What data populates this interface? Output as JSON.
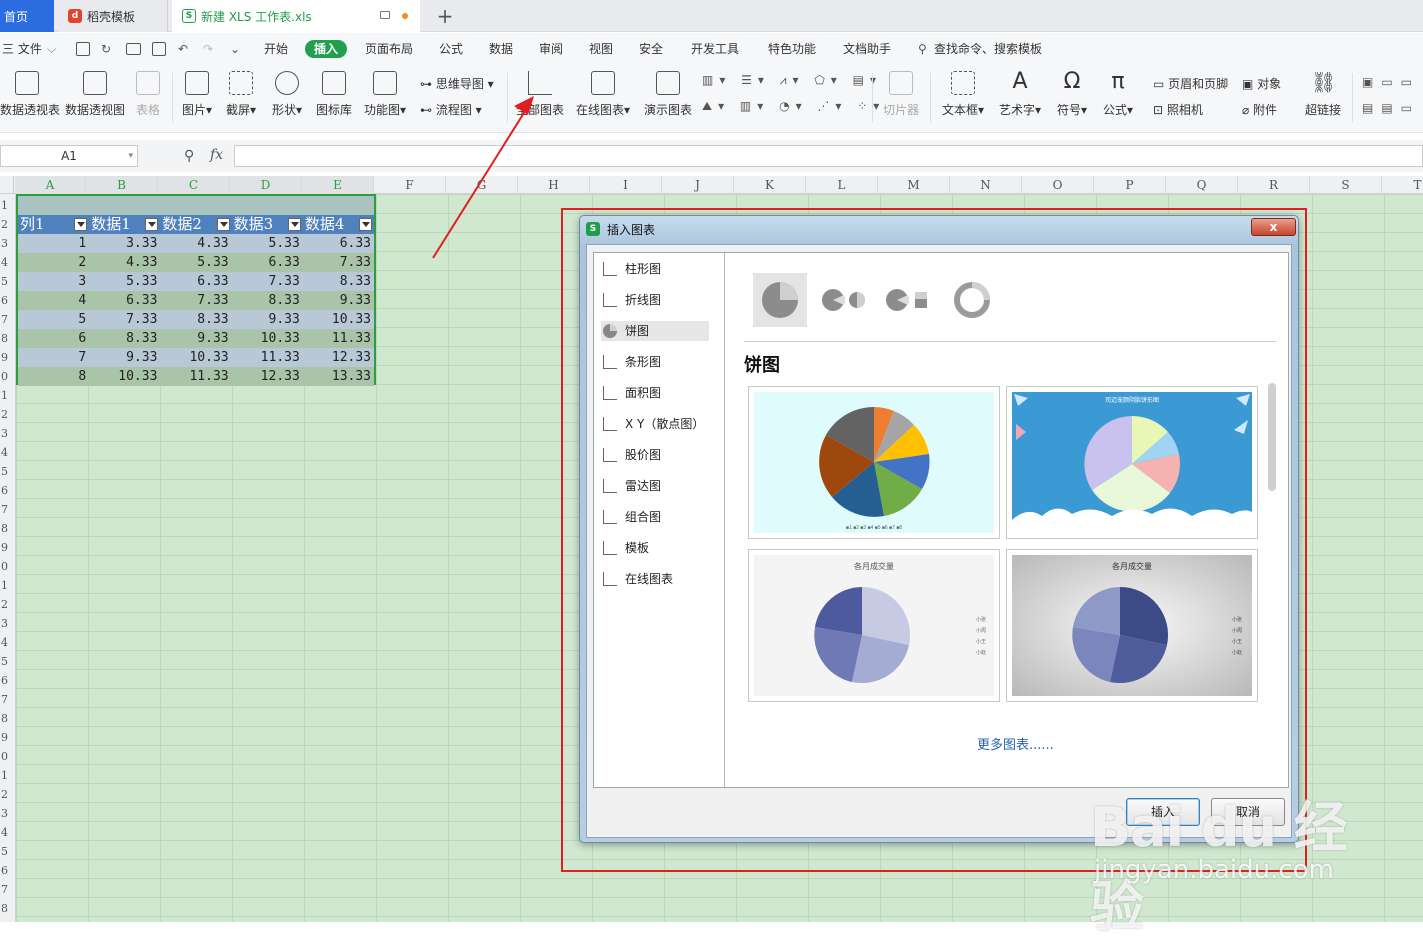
{
  "tabs": {
    "home": "首页",
    "daoke": "稻壳模板",
    "file": "新建 XLS 工作表.xls",
    "plus": "+"
  },
  "menu": {
    "file": "三 文件",
    "items": [
      "开始",
      "插入",
      "页面布局",
      "公式",
      "数据",
      "审阅",
      "视图",
      "安全",
      "开发工具",
      "特色功能",
      "文档助手"
    ],
    "search": "查找命令、搜索模板"
  },
  "ribbon": {
    "pivot_table": "数据透视表",
    "pivot_chart": "数据透视图",
    "table": "表格",
    "picture": "图片",
    "screenshot": "截屏",
    "shapes": "形状",
    "icon_lib": "图标库",
    "function_chart": "功能图",
    "mindmap": "思维导图",
    "flowchart": "流程图",
    "all_charts": "全部图表",
    "online_charts": "在线图表",
    "demo_charts": "演示图表",
    "slicer": "切片器",
    "textbox": "文本框",
    "wordart": "艺术字",
    "symbol": "符号",
    "formula": "公式",
    "header_footer": "页眉和页脚",
    "camera": "照相机",
    "object": "对象",
    "attachment": "附件",
    "hyperlink": "超链接"
  },
  "formula_bar": {
    "cell_ref": "A1",
    "fx": "fx"
  },
  "columns": [
    "A",
    "B",
    "C",
    "D",
    "E",
    "F",
    "G",
    "H",
    "I",
    "J",
    "K",
    "L",
    "M",
    "N",
    "O",
    "P",
    "Q",
    "R",
    "S",
    "T"
  ],
  "rows": [
    "1",
    "2",
    "3",
    "4",
    "5",
    "6",
    "7",
    "8",
    "9",
    "0",
    "1",
    "2",
    "3",
    "4",
    "5",
    "6",
    "7",
    "8",
    "9",
    "0",
    "1",
    "2",
    "3",
    "4",
    "5",
    "6",
    "7",
    "8",
    "9",
    "0",
    "1",
    "2",
    "3",
    "4",
    "5",
    "6",
    "7",
    "8"
  ],
  "table": {
    "headers": [
      "列1",
      "数据1",
      "数据2",
      "数据3",
      "数据4"
    ],
    "rows": [
      [
        "1",
        "3.33",
        "4.33",
        "5.33",
        "6.33"
      ],
      [
        "2",
        "4.33",
        "5.33",
        "6.33",
        "7.33"
      ],
      [
        "3",
        "5.33",
        "6.33",
        "7.33",
        "8.33"
      ],
      [
        "4",
        "6.33",
        "7.33",
        "8.33",
        "9.33"
      ],
      [
        "5",
        "7.33",
        "8.33",
        "9.33",
        "10.33"
      ],
      [
        "6",
        "8.33",
        "9.33",
        "10.33",
        "11.33"
      ],
      [
        "7",
        "9.33",
        "10.33",
        "11.33",
        "12.33"
      ],
      [
        "8",
        "10.33",
        "11.33",
        "12.33",
        "13.33"
      ]
    ]
  },
  "dialog": {
    "title": "插入图表",
    "close": "x",
    "categories": [
      "柱形图",
      "折线图",
      "饼图",
      "条形图",
      "面积图",
      "X Y（散点图）",
      "股价图",
      "雷达图",
      "组合图",
      "模板",
      "在线图表"
    ],
    "selected_category": "饼图",
    "heading": "饼图",
    "thumb2_title": "司迈宠颜阴胎饼形图",
    "thumb3_title": "各月成交量",
    "thumb4_title": "各月成交量",
    "legend_items": [
      "小张",
      "小周",
      "小王",
      "小赵"
    ],
    "more_link": "更多图表......",
    "insert_button": "插入",
    "cancel_button": "取消"
  },
  "watermark": {
    "logo": "Bai du 经验",
    "url": "jingyan.baidu.com"
  },
  "colors": {
    "accent_green": "#22a050",
    "table_header": "#4f81bd",
    "row_band": "#a9c4c0",
    "annotation_red": "#e02020"
  }
}
